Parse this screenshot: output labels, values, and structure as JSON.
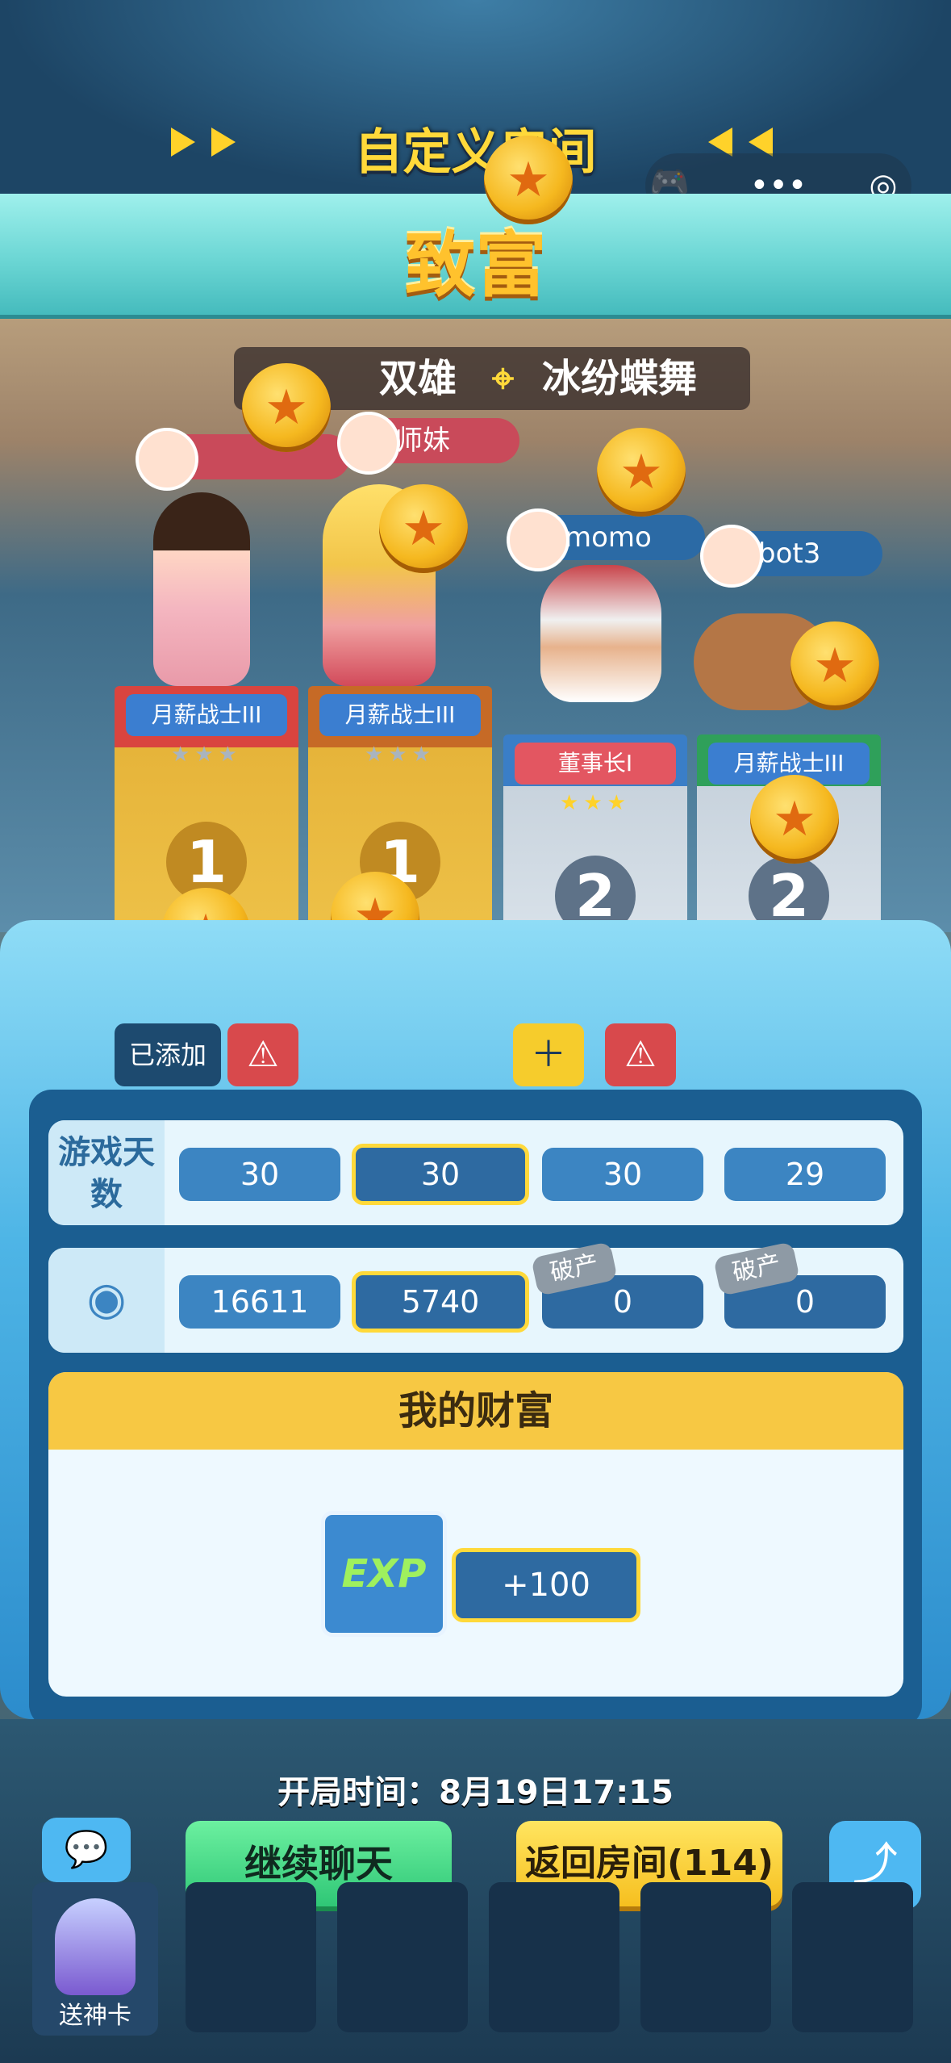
{
  "header": {
    "title": "自定义房间"
  },
  "banner": {
    "text": "致富"
  },
  "scene": {
    "info_left": "双雄",
    "info_right": "冰纷蝶舞",
    "players": [
      {
        "name": "",
        "tag_color": "#c94a5a"
      },
      {
        "name": "师妹",
        "tag_color": "#c94a5a"
      },
      {
        "name": "momo",
        "tag_color": "#2b6aa5"
      },
      {
        "name": "bot3",
        "tag_color": "#2b6aa5"
      }
    ]
  },
  "podiums": [
    {
      "title": "月薪战士III",
      "rank": "1",
      "color": "#e6b43a"
    },
    {
      "title": "月薪战士III",
      "rank": "1",
      "color": "#e6b43a"
    },
    {
      "title": "董事长I",
      "rank": "2",
      "color": "#c8d3dd"
    },
    {
      "title": "月薪战士III",
      "rank": "2",
      "color": "#c8d3dd"
    }
  ],
  "actions": {
    "added_label": "已添加"
  },
  "stats": {
    "days_label": "游戏天数",
    "days": [
      "30",
      "30",
      "30",
      "29"
    ],
    "coins": [
      "16611",
      "5740",
      "0",
      "0"
    ],
    "bankrupt_label": "破产"
  },
  "wealth": {
    "title": "我的财富",
    "exp_label": "EXP",
    "exp_value": "+100"
  },
  "footer": {
    "start_time": "开局时间：8月19日17:15",
    "continue_chat": "继续聊天",
    "back_room": "返回房间(114)",
    "god_card": "送神卡"
  }
}
